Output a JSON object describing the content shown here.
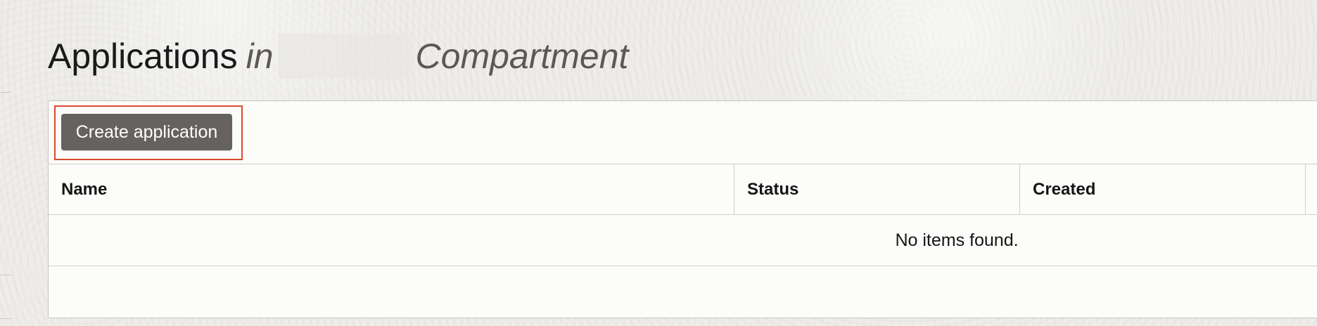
{
  "page": {
    "title_word": "Applications",
    "title_in": "in",
    "title_compartment": "Compartment"
  },
  "toolbar": {
    "create_label": "Create application"
  },
  "table": {
    "columns": [
      "Name",
      "Status",
      "Created"
    ],
    "empty_message": "No items found."
  },
  "colors": {
    "button_background": "#656260",
    "highlight_border": "#d94a2c"
  }
}
